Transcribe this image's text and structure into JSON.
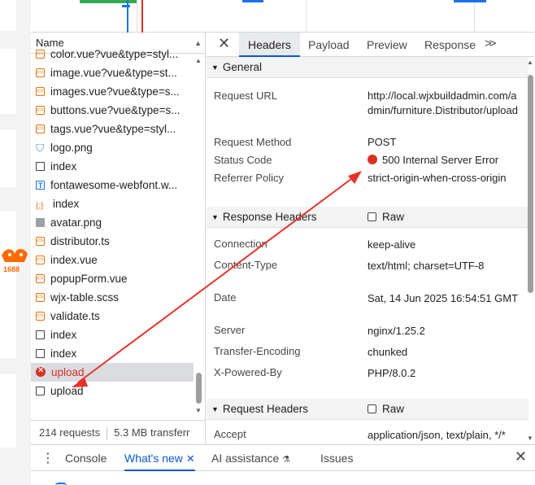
{
  "request_list": {
    "header": "Name",
    "rows": [
      {
        "name": "color.vue?vue&type=styl...",
        "icon": "code-icon"
      },
      {
        "name": "image.vue?vue&type=st...",
        "icon": "code-icon"
      },
      {
        "name": "images.vue?vue&type=s...",
        "icon": "code-icon"
      },
      {
        "name": "buttons.vue?vue&type=s...",
        "icon": "code-icon"
      },
      {
        "name": "tags.vue?vue&type=styl...",
        "icon": "code-icon"
      },
      {
        "name": "logo.png",
        "icon": "shield-image-icon"
      },
      {
        "name": "index",
        "icon": "document-icon"
      },
      {
        "name": "fontawesome-webfont.w...",
        "icon": "font-icon"
      },
      {
        "name": "index",
        "icon": "json-icon"
      },
      {
        "name": "avatar.png",
        "icon": "image-icon"
      },
      {
        "name": "distributor.ts",
        "icon": "code-icon"
      },
      {
        "name": "index.vue",
        "icon": "code-icon"
      },
      {
        "name": "popupForm.vue",
        "icon": "code-icon"
      },
      {
        "name": "wjx-table.scss",
        "icon": "code-icon"
      },
      {
        "name": "validate.ts",
        "icon": "code-icon"
      },
      {
        "name": "index",
        "icon": "document-icon"
      },
      {
        "name": "index",
        "icon": "document-icon"
      },
      {
        "name": "upload",
        "icon": "error-icon",
        "selected": true,
        "error": true
      },
      {
        "name": "upload",
        "icon": "document-icon"
      }
    ],
    "status": {
      "requests": "214 requests",
      "transferred": "5.3 MB transferr"
    }
  },
  "details": {
    "tabs": [
      "Headers",
      "Payload",
      "Preview",
      "Response"
    ],
    "active_tab": "Headers",
    "general": {
      "title": "General",
      "request_url_label": "Request URL",
      "request_url": "http://local.wjxbuildadmin.com/admin/furniture.Distributor/upload",
      "request_method_label": "Request Method",
      "request_method": "POST",
      "status_code_label": "Status Code",
      "status_code": "500 Internal Server Error",
      "referrer_policy_label": "Referrer Policy",
      "referrer_policy": "strict-origin-when-cross-origin"
    },
    "response_headers": {
      "title": "Response Headers",
      "raw_label": "Raw",
      "items": [
        {
          "key": "Connection",
          "value": "keep-alive"
        },
        {
          "key": "Content-Type",
          "value": "text/html; charset=UTF-8"
        },
        {
          "key": "Date",
          "value": "Sat, 14 Jun 2025 16:54:51 GMT"
        },
        {
          "key": "Server",
          "value": "nginx/1.25.2"
        },
        {
          "key": "Transfer-Encoding",
          "value": "chunked"
        },
        {
          "key": "X-Powered-By",
          "value": "PHP/8.0.2"
        }
      ]
    },
    "request_headers": {
      "title": "Request Headers",
      "raw_label": "Raw",
      "items": [
        {
          "key": "Accept",
          "value": "application/json, text/plain, */*"
        }
      ]
    }
  },
  "drawer": {
    "tabs": [
      "Console",
      "What's new",
      "AI assistance",
      "Issues"
    ],
    "active_tab": "What's new"
  },
  "page_behind": {
    "badge_text": "1688"
  },
  "colors": {
    "accent": "#0b57d0",
    "error": "#d93025",
    "annotation_arrow": "#e8322c"
  }
}
